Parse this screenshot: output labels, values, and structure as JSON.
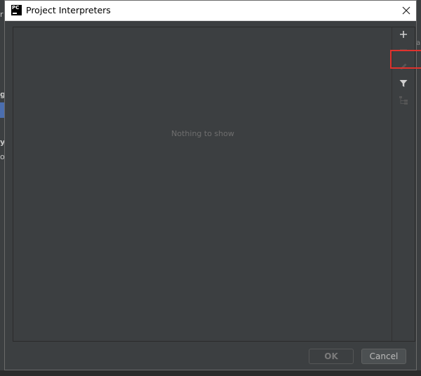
{
  "window": {
    "title": "Project Interpreters",
    "logo_text": "PC"
  },
  "list": {
    "empty_text": "Nothing to show"
  },
  "toolbar": {
    "items": [
      {
        "name": "add-icon",
        "enabled": true
      },
      {
        "name": "remove-icon",
        "enabled": false
      },
      {
        "name": "edit-icon",
        "enabled": false
      },
      {
        "name": "filter-icon",
        "enabled": true
      },
      {
        "name": "tree-icon",
        "enabled": false
      }
    ]
  },
  "buttons": {
    "ok_label": "OK",
    "cancel_label": "Cancel"
  },
  "background": {
    "left_fragments": [
      "r",
      "g",
      "y",
      "or"
    ],
    "right_fragment": "a"
  },
  "colors": {
    "dialog_bg": "#3c3f41",
    "highlight": "#e0322d",
    "selection": "#4b6eaf"
  }
}
